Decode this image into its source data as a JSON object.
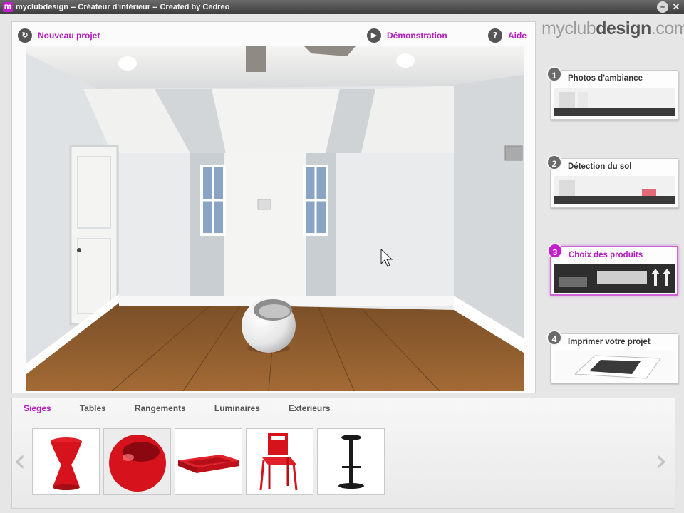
{
  "window": {
    "app_icon": "m",
    "title": "myclubdesign -- Créateur d'intérieur -- Created by Cedreo",
    "minimize_icon": "–",
    "close_icon": "✕"
  },
  "toolbar": {
    "new_project_label": "Nouveau projet",
    "new_project_icon": "↻",
    "demo_label": "Démonstration",
    "demo_icon": "▶",
    "help_label": "Aide",
    "help_icon": "?"
  },
  "brand": {
    "part1": "myclub",
    "part2": "design",
    "part3": ".com"
  },
  "steps": [
    {
      "number": "1",
      "label": "Photos d'ambiance"
    },
    {
      "number": "2",
      "label": "Détection du sol"
    },
    {
      "number": "3",
      "label": "Choix des produits"
    },
    {
      "number": "4",
      "label": "Imprimer votre projet"
    }
  ],
  "catalog": {
    "tabs": [
      "Sieges",
      "Tables",
      "Rangements",
      "Luminaires",
      "Exterieurs"
    ],
    "selected_tab": "Sieges",
    "prev_icon": "‹",
    "next_icon": "›",
    "products": [
      {
        "icon": "red-stool-icon"
      },
      {
        "icon": "red-egg-chair-icon"
      },
      {
        "icon": "red-low-table-icon"
      },
      {
        "icon": "red-chair-icon"
      },
      {
        "icon": "black-bar-stool-icon"
      }
    ]
  },
  "colors": {
    "accent": "#b51bbf",
    "product_red": "#d6121c"
  }
}
